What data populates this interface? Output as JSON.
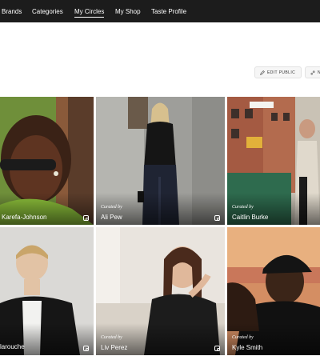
{
  "nav": {
    "items": [
      {
        "label": "Brands"
      },
      {
        "label": "Categories"
      },
      {
        "label": "My Circles"
      },
      {
        "label": "My Shop"
      },
      {
        "label": "Taste Profile"
      }
    ],
    "active": "My Circles"
  },
  "actions": {
    "edit_public": "EDIT PUBLIC",
    "second": "N"
  },
  "grid": {
    "curated_label": "Curated by",
    "tiles": [
      {
        "name": "Karefa-Johnson",
        "curated": ""
      },
      {
        "name": "Ali Pew",
        "curated": "Curated by"
      },
      {
        "name": "Caitlin Burke",
        "curated": "Curated by"
      },
      {
        "name": "larouche",
        "curated": ""
      },
      {
        "name": "Liv Perez",
        "curated": "Curated by"
      },
      {
        "name": "Kyle Smith",
        "curated": "Curated by"
      }
    ]
  }
}
